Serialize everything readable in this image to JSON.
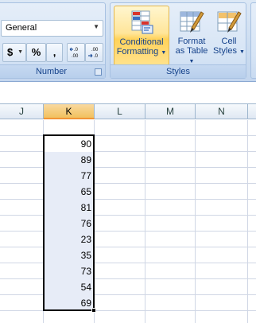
{
  "ribbon": {
    "number_group": {
      "label": "Number",
      "format_value": "General",
      "currency_symbol": "$",
      "percent_symbol": "%",
      "comma_symbol": ",",
      "increase_decimal": "←.0\n.00",
      "decrease_decimal": ".00\n→.0"
    },
    "styles_group": {
      "label": "Styles",
      "conditional_formatting": [
        "Conditional",
        "Formatting"
      ],
      "format_as_table": [
        "Format",
        "as Table"
      ],
      "cell_styles": [
        "Cell",
        "Styles"
      ]
    }
  },
  "sheet": {
    "columns": [
      "J",
      "K",
      "L",
      "M",
      "N"
    ],
    "active_column": "K",
    "k_values": [
      "90",
      "89",
      "77",
      "65",
      "81",
      "76",
      "23",
      "35",
      "73",
      "54",
      "69"
    ]
  },
  "colors": {
    "selection_border": "#000000",
    "selection_fill": "#e7ecf7",
    "active_header": "#f1c15f",
    "ribbon_text": "#15428b"
  }
}
